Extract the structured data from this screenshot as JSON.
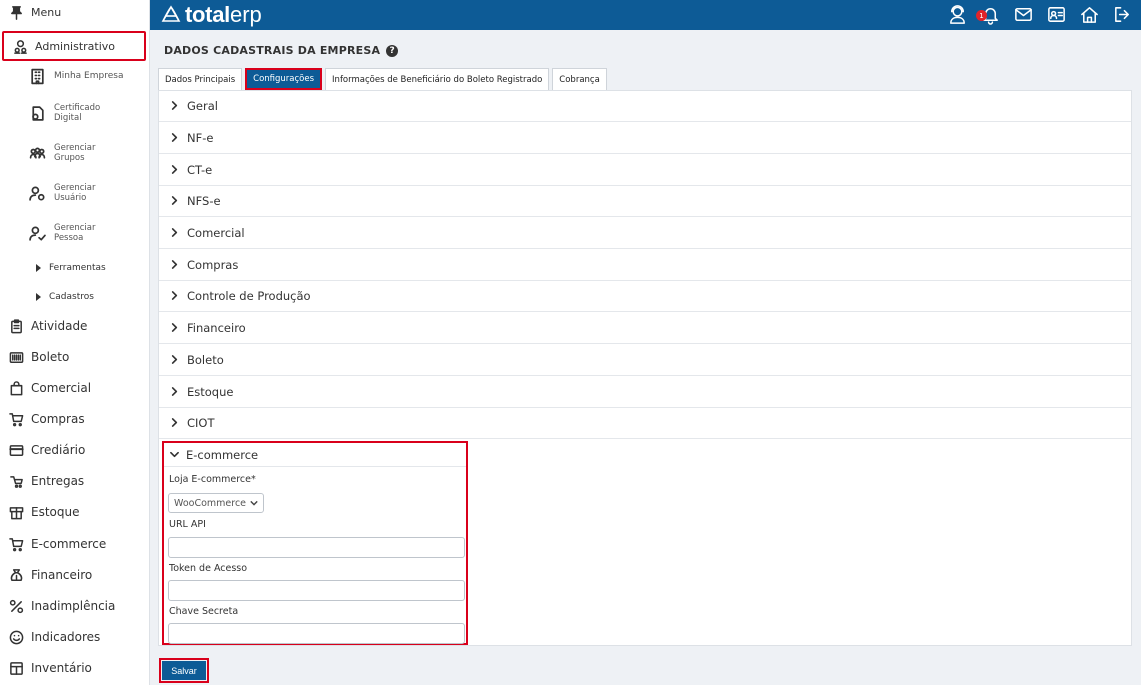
{
  "header": {
    "logo_bold": "total",
    "logo_thin": "erp",
    "notification_count": "1"
  },
  "sidebar": {
    "menu_label": "Menu",
    "administrativo": "Administrativo",
    "sub": {
      "minha_empresa": "Minha Empresa",
      "certificado_1": "Certificado",
      "certificado_2": "Digital",
      "grupos_1": "Gerenciar",
      "grupos_2": "Grupos",
      "usuario_1": "Gerenciar",
      "usuario_2": "Usuário",
      "pessoa_1": "Gerenciar",
      "pessoa_2": "Pessoa",
      "ferramentas": "Ferramentas",
      "cadastros": "Cadastros"
    },
    "items": [
      {
        "label": "Atividade",
        "icon": "clipboard-icon"
      },
      {
        "label": "Boleto",
        "icon": "barcode-icon"
      },
      {
        "label": "Comercial",
        "icon": "shopping-bag-icon"
      },
      {
        "label": "Compras",
        "icon": "cart-icon"
      },
      {
        "label": "Crediário",
        "icon": "credit-card-icon"
      },
      {
        "label": "Entregas",
        "icon": "delivery-icon"
      },
      {
        "label": "Estoque",
        "icon": "box-icon"
      },
      {
        "label": "E-commerce",
        "icon": "cart-icon"
      },
      {
        "label": "Financeiro",
        "icon": "money-bag-icon"
      },
      {
        "label": "Inadimplência",
        "icon": "percent-icon"
      },
      {
        "label": "Indicadores",
        "icon": "smile-icon"
      },
      {
        "label": "Inventário",
        "icon": "inventory-icon"
      }
    ]
  },
  "main": {
    "title": "DADOS CADASTRAIS DA EMPRESA",
    "tabs": [
      {
        "label": "Dados Principais"
      },
      {
        "label": "Configurações"
      },
      {
        "label": "Informações de Beneficiário do Boleto Registrado"
      },
      {
        "label": "Cobrança"
      }
    ],
    "sections": [
      "Geral",
      "NF-e",
      "CT-e",
      "NFS-e",
      "Comercial",
      "Compras",
      "Controle de Produção",
      "Financeiro",
      "Boleto",
      "Estoque",
      "CIOT"
    ],
    "ecommerce": {
      "title": "E-commerce",
      "loja_label": "Loja E-commerce*",
      "loja_value": "WooCommerce",
      "url_label": "URL API",
      "url_value": "",
      "token_label": "Token de Acesso",
      "token_value": "",
      "chave_label": "Chave Secreta",
      "chave_value": ""
    },
    "save_label": "Salvar"
  },
  "colors": {
    "header_bg": "#0d5b96",
    "highlight": "#d9001b",
    "badge": "#e0242a"
  }
}
